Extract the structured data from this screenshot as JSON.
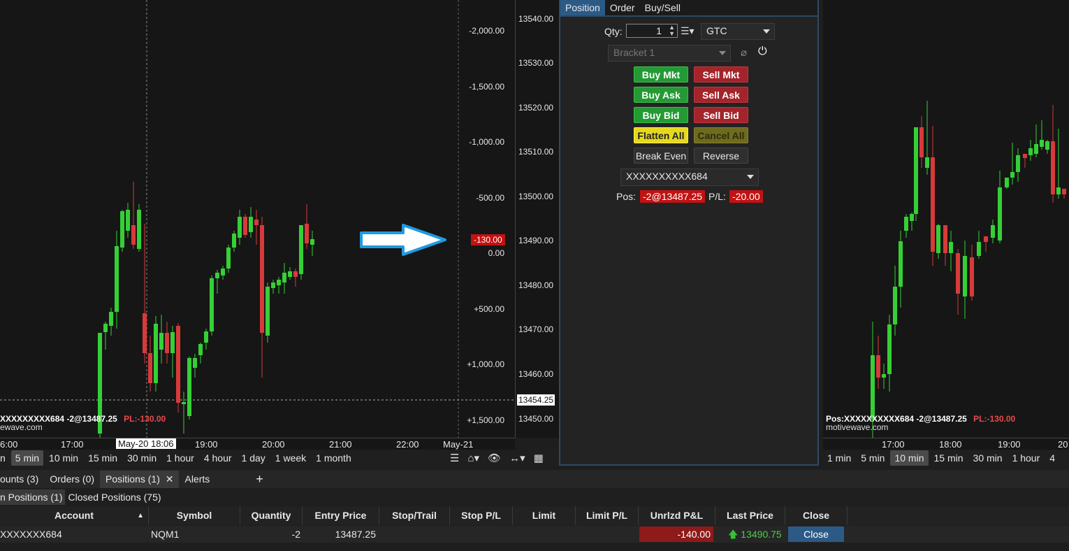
{
  "left_chart": {
    "pl_axis_labels": [
      "-2,000.00",
      "-1,500.00",
      "-1,000.00",
      "-500.00",
      "0.00",
      "+500.00",
      "+1,000.00",
      "+1,500.00"
    ],
    "pl_marker": "-130.00",
    "price_axis_labels": [
      "13540.00",
      "13530.00",
      "13520.00",
      "13510.00",
      "13500.00",
      "13490.00",
      "13480.00",
      "13470.00",
      "13460.00",
      "13450.00"
    ],
    "price_marker": "13454.25",
    "position_line": "XXXXXXXXX684 -2@13487.25",
    "pl_text": "PL:-130.00",
    "watermark": "ewave.com",
    "time_labels": [
      "6:00",
      "17:00",
      "19:00",
      "20:00",
      "21:00",
      "22:00",
      "May-21"
    ],
    "crosshair_time": "May-20 18:06",
    "timeframes": [
      "n",
      "5 min",
      "10 min",
      "15 min",
      "30 min",
      "1 hour",
      "4 hour",
      "1 day",
      "1 week",
      "1 month"
    ],
    "selected_timeframe": "5 min"
  },
  "right_chart": {
    "position_line": "Pos:XXXXXXXXXX684 -2@13487.25",
    "pl_text": "PL:-130.00",
    "watermark": "motivewave.com",
    "time_labels": [
      "17:00",
      "18:00",
      "19:00",
      "20"
    ],
    "timeframes": [
      "1 min",
      "5 min",
      "10 min",
      "15 min",
      "30 min",
      "1 hour",
      "4"
    ],
    "selected_timeframe": "10 min"
  },
  "order_panel": {
    "tabs": [
      "Position",
      "Order",
      "Buy/Sell"
    ],
    "qty_label": "Qty:",
    "qty_value": "1",
    "tif_value": "GTC",
    "bracket_value": "Bracket 1",
    "buttons": {
      "buy_mkt": "Buy Mkt",
      "sell_mkt": "Sell Mkt",
      "buy_ask": "Buy Ask",
      "sell_ask": "Sell Ask",
      "buy_bid": "Buy Bid",
      "sell_bid": "Sell Bid",
      "flatten_all": "Flatten All",
      "cancel_all": "Cancel All",
      "break_even": "Break Even",
      "reverse": "Reverse"
    },
    "account_value": "XXXXXXXXXX684",
    "pos_label": "Pos:",
    "pos_value": "-2@13487.25",
    "pl_label": "P/L:",
    "pl_value": "-20.00"
  },
  "bottom": {
    "tabs": [
      "ounts (3)",
      "Orders (0)",
      "Positions (1)",
      "Alerts"
    ],
    "active_tab": "Positions (1)",
    "add_tab": "+",
    "subtabs": [
      "n Positions (1)",
      "Closed Positions (75)"
    ],
    "columns": [
      "Account",
      "Symbol",
      "Quantity",
      "Entry Price",
      "Stop/Trail",
      "Stop P/L",
      "Limit",
      "Limit P/L",
      "Unrlzd P&L",
      "Last Price",
      "Close"
    ],
    "row": {
      "account": "XXXXXXX684",
      "symbol": "NQM1",
      "quantity": "-2",
      "entry_price": "13487.25",
      "unrlzd": "-140.00",
      "last_price": "13490.75",
      "close": "Close"
    }
  },
  "colors": {
    "bull": "#35d036",
    "bear": "#d83a3a",
    "accent": "#2c5a86",
    "arrow": "#1e9be0"
  }
}
